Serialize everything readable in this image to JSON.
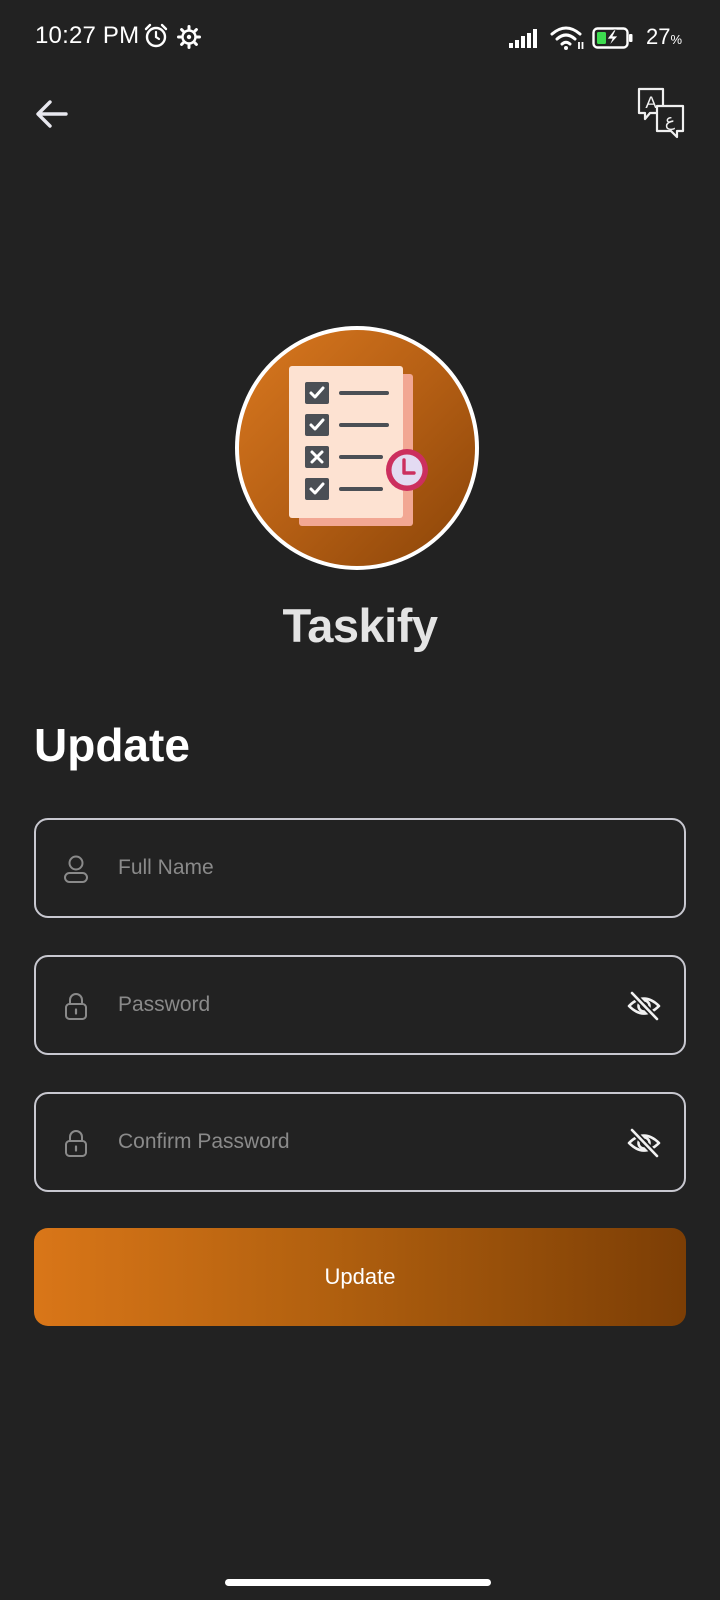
{
  "status_bar": {
    "time": "10:27 PM",
    "battery_percent": "27",
    "battery_unit": "%",
    "icons": [
      "alarm-icon",
      "settings-gear-icon",
      "signal-icon",
      "wifi-icon",
      "battery-charging-icon"
    ]
  },
  "toolbar": {
    "back_icon": "arrow-left-icon",
    "language_icon": "translate-icon",
    "language_glyph_latin": "A",
    "language_glyph_arabic": "ع"
  },
  "brand": {
    "app_name": "Taskify",
    "logo_icon": "task-checklist-clock-icon"
  },
  "form": {
    "heading": "Update",
    "fields": [
      {
        "placeholder": "Full Name",
        "value": "",
        "icon": "user-icon"
      },
      {
        "placeholder": "Password",
        "value": "",
        "icon": "lock-icon",
        "toggle_icon": "eye-off-icon"
      },
      {
        "placeholder": "Confirm Password",
        "value": "",
        "icon": "lock-icon",
        "toggle_icon": "eye-off-icon"
      }
    ],
    "submit_label": "Update"
  },
  "colors": {
    "background": "#222222",
    "accent_start": "#d97618",
    "accent_end": "#7c3e05",
    "field_border": "#c8c8d0",
    "placeholder": "#8a8a8a"
  }
}
